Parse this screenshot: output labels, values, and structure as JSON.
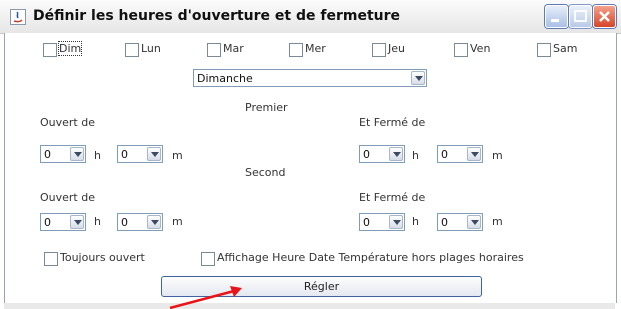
{
  "window": {
    "title": "Définir les heures d'ouverture et de fermeture"
  },
  "days": [
    {
      "label": "Dim",
      "checked": false
    },
    {
      "label": "Lun",
      "checked": false
    },
    {
      "label": "Mar",
      "checked": false
    },
    {
      "label": "Mer",
      "checked": false
    },
    {
      "label": "Jeu",
      "checked": false
    },
    {
      "label": "Ven",
      "checked": false
    },
    {
      "label": "Sam",
      "checked": false
    }
  ],
  "day_select": {
    "value": "Dimanche"
  },
  "premier": {
    "heading": "Premier",
    "open_label": "Ouvert de",
    "close_label": "Et Fermé de",
    "open_h": "0",
    "open_m": "0",
    "close_h": "0",
    "close_m": "0"
  },
  "second": {
    "heading": "Second",
    "open_label": "Ouvert de",
    "close_label": "Et Fermé de",
    "open_h": "0",
    "open_m": "0",
    "close_h": "0",
    "close_m": "0"
  },
  "units": {
    "h": "h",
    "m": "m"
  },
  "options": {
    "toujours": "Toujours ouvert",
    "affichage": "Affichage Heure Date Température hors plages horaires"
  },
  "apply_button": {
    "label": "Régler"
  },
  "colors": {
    "annotation_arrow": "#e8141a",
    "close_button": "#d5472a",
    "accent_border": "#3f63a0"
  }
}
